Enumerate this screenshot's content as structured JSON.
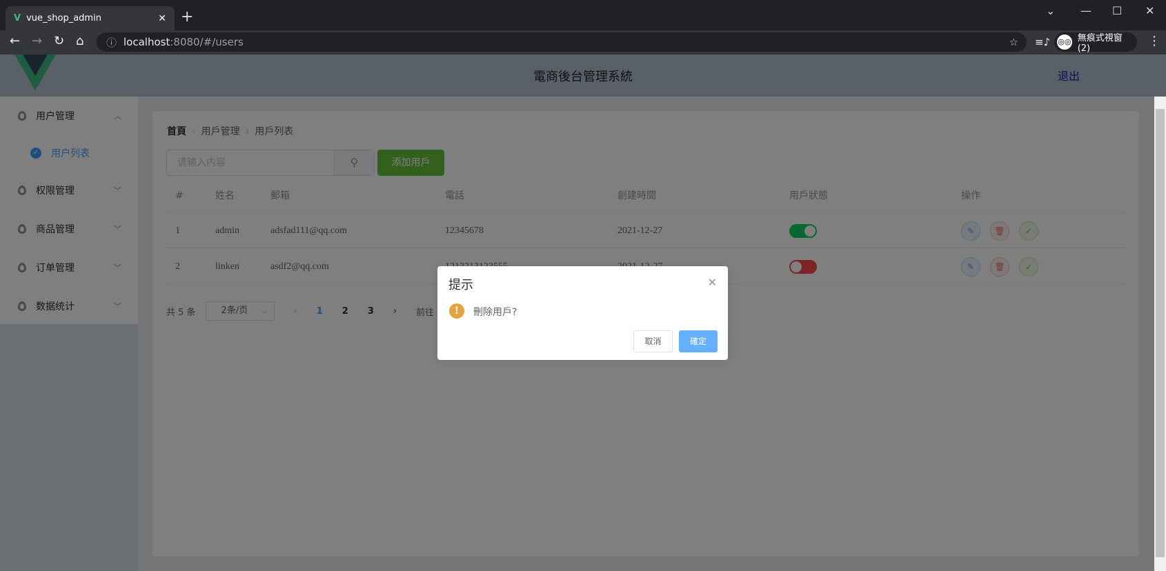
{
  "browser": {
    "tab_title": "vue_shop_admin",
    "url_host": "localhost",
    "url_path": ":8080/#/users",
    "profile": "無痕式視窗 (2)"
  },
  "header": {
    "title": "電商後台管理系統",
    "logout": "退出"
  },
  "sidebar": {
    "items": [
      {
        "label": "用户管理",
        "expanded": true,
        "children": [
          {
            "label": "用户列表",
            "active": true
          }
        ]
      },
      {
        "label": "权限管理"
      },
      {
        "label": "商品管理"
      },
      {
        "label": "订单管理"
      },
      {
        "label": "数据统计"
      }
    ]
  },
  "breadcrumb": [
    "首頁",
    "用戶管理",
    "用戶列表"
  ],
  "search": {
    "placeholder": "请输入内容"
  },
  "add_button": "添加用戶",
  "table": {
    "columns": [
      "#",
      "姓名",
      "郵箱",
      "電話",
      "創建時間",
      "用戶狀態",
      "操作"
    ],
    "rows": [
      {
        "index": "1",
        "name": "admin",
        "email": "adsfad111@qq.com",
        "phone": "12345678",
        "created": "2021-12-27",
        "status": true
      },
      {
        "index": "2",
        "name": "linken",
        "email": "asdf2@qq.com",
        "phone": "1213213123555",
        "created": "2021-12-27",
        "status": false
      }
    ]
  },
  "pagination": {
    "total": "共 5 条",
    "page_size": "2条/页",
    "pages": [
      "1",
      "2",
      "3"
    ],
    "current": "1",
    "goto": "前往"
  },
  "dialog": {
    "title": "提示",
    "message": "刪除用戶?",
    "cancel": "取消",
    "confirm": "確定"
  },
  "colors": {
    "switch_on": "#13ce66",
    "switch_off": "#ff4949",
    "primary": "#409eff",
    "success": "#67c23a",
    "warning": "#e6a23c"
  }
}
